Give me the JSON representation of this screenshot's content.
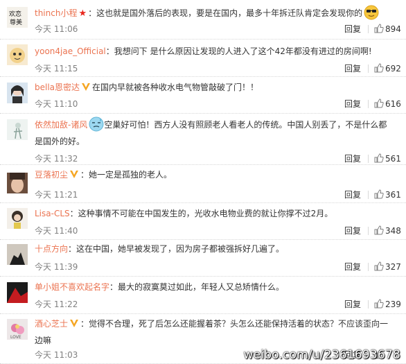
{
  "accent_color": "#eb7350",
  "comments": [
    {
      "user": "thinch小程",
      "badge": "star",
      "text": "：这也就是国外落后的表现，要是在国内，最多十年拆迁队肯定会发现你的",
      "emoji": "cool-sunglasses-emoji",
      "time": "今天 11:06",
      "reply": "回复",
      "likes": "894",
      "avatar": "calligraphy"
    },
    {
      "user": "yoon4jae_Official",
      "badge": "",
      "text": "：我想问下 是什么原因让发现的人进入了这个42年都没有进过的房间啊!",
      "emoji": "",
      "time": "今天 11:15",
      "reply": "回复",
      "likes": "692",
      "avatar": "cartoon"
    },
    {
      "user": "bella恩密达",
      "badge": "v",
      "text": "在国内早就被各种收水电气物管敲破了门！！",
      "emoji": "",
      "time": "今天 11:10",
      "reply": "回复",
      "likes": "616",
      "avatar": "portrait"
    },
    {
      "user": "依然加敌-诸风",
      "badge": "",
      "text": "空巢好可怕！西方人没有照顾老人看老人的传统。中国人别丢了，不是什么都是国外的好。",
      "emoji": "sweat-face-emoji",
      "time": "今天 11:32",
      "reply": "回复",
      "likes": "561",
      "avatar": "sketch"
    },
    {
      "user": "豆落初尘",
      "badge": "v",
      "text": "：她一定是孤独的老人。",
      "emoji": "",
      "time": "今天 11:21",
      "reply": "回复",
      "likes": "361",
      "avatar": "face"
    },
    {
      "user": "Lisa-CLS",
      "badge": "",
      "text": "：这种事情不可能在中国发生的，光收水电物业费的就让你撑不过2月。",
      "emoji": "",
      "time": "今天 11:40",
      "reply": "回复",
      "likes": "348",
      "avatar": "girl"
    },
    {
      "user": "十点方向",
      "badge": "",
      "text": "：这在中国，她早被发现了，因为房子都被强拆好几遍了。",
      "emoji": "",
      "time": "今天 11:39",
      "reply": "回复",
      "likes": "327",
      "avatar": "silhouette"
    },
    {
      "user": "单小姐不喜欢起名字",
      "badge": "",
      "text": "：最大的寂寞莫过如此，年轻人又总矫情什么。",
      "emoji": "",
      "time": "今天 11:22",
      "reply": "回复",
      "likes": "239",
      "avatar": "red"
    },
    {
      "user": "酒心芝士",
      "badge": "v",
      "text": "：觉得不合理，死了后怎么还能握着茶？头怎么还能保持活着的状态？不应该歪向一边嘛",
      "emoji": "",
      "time": "今天 11:03",
      "reply": "回复",
      "likes": "",
      "avatar": "flower"
    }
  ],
  "watermark": "weibo.com/u/2361693678"
}
